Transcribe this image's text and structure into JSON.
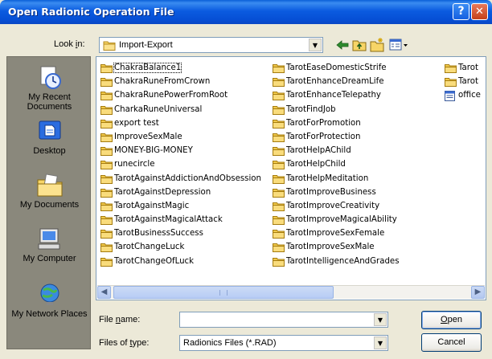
{
  "window": {
    "title": "Open Radionic Operation File",
    "help_glyph": "?",
    "close_glyph": "✕"
  },
  "lookin": {
    "label_pre": "Look ",
    "label_mnemonic": "i",
    "label_post": "n:",
    "value": "Import-Export",
    "arrow": "▼"
  },
  "places": [
    {
      "label": "My Recent Documents",
      "icon": "recent-documents-icon"
    },
    {
      "label": "Desktop",
      "icon": "desktop-icon"
    },
    {
      "label": "My Documents",
      "icon": "my-documents-icon"
    },
    {
      "label": "My Computer",
      "icon": "my-computer-icon"
    },
    {
      "label": "My Network Places",
      "icon": "network-places-icon"
    }
  ],
  "files": {
    "col1": [
      "ChakraBalance1",
      "ChakraRuneFromCrown",
      "ChakraRunePowerFromRoot",
      "CharkaRuneUniversal",
      "export test",
      "ImproveSexMale",
      "MONEY-BIG-MONEY",
      "runecircle",
      "TarotAgainstAddictionAndObsession",
      "TarotAgainstDepression",
      "TarotAgainstMagic",
      "TarotAgainstMagicalAttack",
      "TarotBusinessSuccess",
      "TarotChangeLuck",
      "TarotChangeOfLuck"
    ],
    "col2": [
      "TarotEaseDomesticStrife",
      "TarotEnhanceDreamLife",
      "TarotEnhanceTelepathy",
      "TarotFindJob",
      "TarotForPromotion",
      "TarotForProtection",
      "TarotHelpAChild",
      "TarotHelpChild",
      "TarotHelpMeditation",
      "TarotImproveBusiness",
      "TarotImproveCreativity",
      "TarotImproveMagicalAbility",
      "TarotImproveSexFemale",
      "TarotImproveSexMale",
      "TarotIntelligenceAndGrades"
    ],
    "col3": [
      {
        "name": "Tarot",
        "icon": "folder-icon"
      },
      {
        "name": "Tarot",
        "icon": "folder-icon"
      },
      {
        "name": "office",
        "icon": "document-file-icon"
      }
    ]
  },
  "scrollbar": {
    "left": "◀",
    "right": "▶"
  },
  "filename": {
    "label_pre": "File ",
    "label_mnemonic": "n",
    "label_post": "ame:",
    "value": "",
    "arrow": "▼"
  },
  "filetype": {
    "label_pre": "Files of ",
    "label_mnemonic": "t",
    "label_post": "ype:",
    "value": "Radionics Files (*.RAD)",
    "arrow": "▼"
  },
  "buttons": {
    "open_mnemonic": "O",
    "open_rest": "pen",
    "cancel": "Cancel"
  }
}
